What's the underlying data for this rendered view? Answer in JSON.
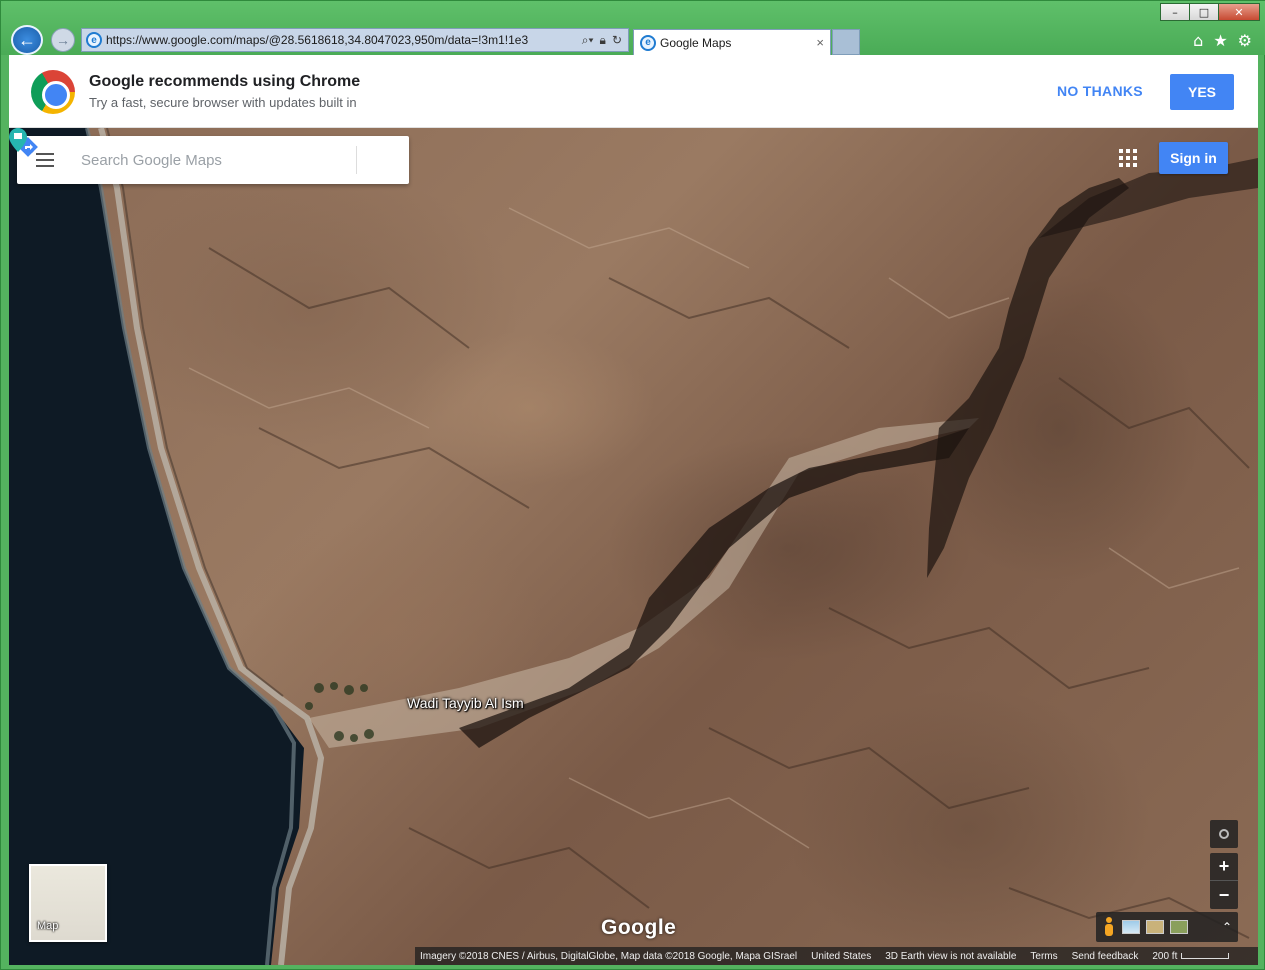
{
  "browser": {
    "url": "https://www.google.com/maps/@28.5618618,34.8047023,950m/data=!3m1!1e3",
    "tab_title": "Google Maps",
    "tab_close": "×",
    "window_buttons": {
      "minimize": "–",
      "maximize": "□",
      "close": "✕"
    }
  },
  "chrome_promo": {
    "title": "Google recommends using Chrome",
    "subtitle": "Try a fast, secure browser with updates built in",
    "no_thanks": "NO THANKS",
    "yes": "YES"
  },
  "maps": {
    "search_placeholder": "Search Google Maps",
    "sign_in": "Sign in",
    "place_label": "Wadi Tayyib Al Ism",
    "layer_toggle_label": "Map",
    "logo": "Google",
    "attribution": {
      "imagery": "Imagery ©2018 CNES / Airbus, DigitalGlobe, Map data ©2018 Google, Mapa GISrael",
      "region": "United States",
      "earth_note": "3D Earth view is not available",
      "terms": "Terms",
      "feedback": "Send feedback",
      "scale": "200 ft"
    }
  },
  "icons": [
    "back-arrow-icon",
    "forward-arrow-icon",
    "ie-icon",
    "search-icon",
    "lock-icon",
    "refresh-icon",
    "home-icon",
    "star-icon",
    "gear-icon",
    "hamburger-icon",
    "directions-icon",
    "apps-grid-icon",
    "place-pin-icon",
    "locate-icon",
    "zoom-in-icon",
    "zoom-out-icon",
    "pegman-icon",
    "expand-up-icon"
  ],
  "colors": {
    "accent": "#4285f4",
    "window_frame": "#54b35f",
    "sea": "#0d1a26",
    "terrain": "#8a6a55"
  }
}
